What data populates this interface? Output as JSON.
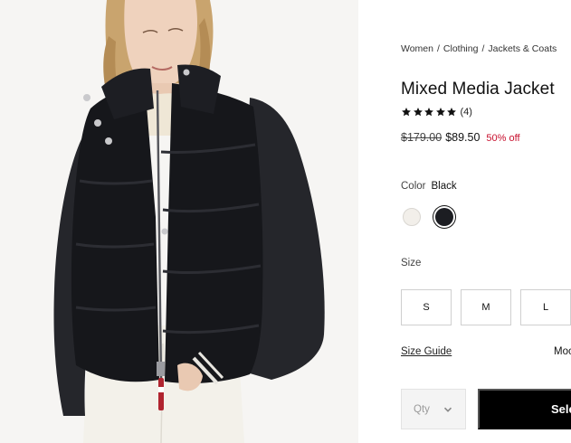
{
  "breadcrumb": {
    "items": [
      "Women",
      "Clothing",
      "Jackets & Coats"
    ],
    "separator": "/"
  },
  "product": {
    "title": "Mixed Media Jacket",
    "rating": {
      "stars": 5,
      "count_label": "(4)"
    },
    "price": {
      "original": "$179.00",
      "sale": "$89.50",
      "discount": "50% off"
    }
  },
  "color": {
    "label": "Color",
    "selected": "Black",
    "swatches": [
      {
        "name": "ivory",
        "hex": "#f2efea"
      },
      {
        "name": "black",
        "hex": "#1c1d22",
        "selected": true
      }
    ]
  },
  "size": {
    "label": "Size",
    "options": [
      "S",
      "M",
      "L"
    ],
    "guide_label": "Size Guide",
    "model_info_label": "Moc"
  },
  "purchase": {
    "qty_placeholder": "Qty",
    "select_button_label": "Sele"
  },
  "colors": {
    "sale_red": "#c8102e",
    "button_black": "#000000"
  }
}
